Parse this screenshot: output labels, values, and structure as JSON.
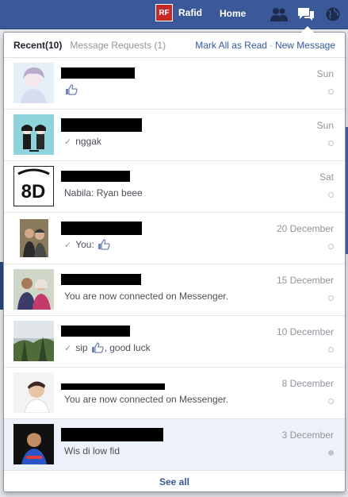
{
  "topbar": {
    "profile_badge": "RF",
    "profile_name": "Rafid",
    "home_label": "Home"
  },
  "flyout": {
    "tab_recent": "Recent",
    "tab_recent_count": "(10)",
    "tab_requests": "Message Requests",
    "tab_requests_count": "(1)",
    "mark_all_read": "Mark All as Read",
    "separator": "·",
    "new_message": "New Message",
    "see_all": "See all"
  },
  "conversations": [
    {
      "snippet": "",
      "has_like": true,
      "like_position": "only",
      "check": false,
      "time": "Sun",
      "unread": false
    },
    {
      "snippet": "nggak",
      "has_like": false,
      "check": true,
      "time": "Sun",
      "unread": false
    },
    {
      "snippet": "Nabila: Ryan beee",
      "has_like": false,
      "check": false,
      "time": "Sat",
      "unread": false
    },
    {
      "snippet": "You:",
      "has_like": true,
      "like_position": "after",
      "check": true,
      "time": "20 December",
      "unread": false
    },
    {
      "snippet": "You are now connected on Messenger.",
      "has_like": false,
      "check": false,
      "time": "15 December",
      "unread": false
    },
    {
      "snippet": "sip",
      "snippet_after": ", good luck",
      "has_like": true,
      "like_position": "middle",
      "check": true,
      "time": "10 December",
      "unread": false
    },
    {
      "snippet": "You are now connected on Messenger.",
      "has_like": false,
      "check": false,
      "time": "8 December",
      "unread": false
    },
    {
      "snippet": "Wis di low fid",
      "has_like": false,
      "check": false,
      "time": "3 December",
      "unread": true
    }
  ],
  "colors": {
    "brand": "#3b5998",
    "link": "#365899",
    "unread_bg": "#edf2fa"
  }
}
